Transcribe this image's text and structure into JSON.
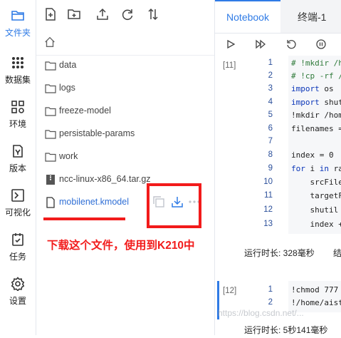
{
  "rail": {
    "items": [
      {
        "label": "文件夹",
        "icon": "folder-icon",
        "active": true
      },
      {
        "label": "数据集",
        "icon": "dataset-icon"
      },
      {
        "label": "环境",
        "icon": "environment-icon"
      },
      {
        "label": "版本",
        "icon": "version-icon"
      },
      {
        "label": "可视化",
        "icon": "visualization-icon"
      },
      {
        "label": "任务",
        "icon": "task-icon"
      },
      {
        "label": "设置",
        "icon": "settings-icon"
      }
    ]
  },
  "file_toolbar": {
    "icons": [
      "new-file-icon",
      "new-folder-icon",
      "upload-icon",
      "refresh-icon",
      "sort-icon"
    ]
  },
  "breadcrumb": {
    "icon": "home-icon"
  },
  "files": [
    {
      "name": "data",
      "type": "folder"
    },
    {
      "name": "logs",
      "type": "folder"
    },
    {
      "name": "freeze-model",
      "type": "folder"
    },
    {
      "name": "persistable-params",
      "type": "folder"
    },
    {
      "name": "work",
      "type": "folder"
    },
    {
      "name": "ncc-linux-x86_64.tar.gz",
      "type": "archive"
    },
    {
      "name": "mobilenet.kmodel",
      "type": "file",
      "selected": true
    }
  ],
  "annotation": {
    "text": "下载这个文件，使用到K210中",
    "color": "#f21b1b"
  },
  "tabs": [
    {
      "label": "Notebook",
      "active": true
    },
    {
      "label": "终端-1",
      "active": false
    }
  ],
  "nb_toolbar": {
    "icons": [
      "run-icon",
      "run-all-icon",
      "restart-icon",
      "stop-icon"
    ]
  },
  "cells": [
    {
      "exec_count": "[11]",
      "lines": [
        {
          "n": "1",
          "text": "# !mkdir /h"
        },
        {
          "n": "2",
          "text": "# !cp -rf /"
        },
        {
          "n": "3",
          "text": "import os"
        },
        {
          "n": "4",
          "text": "import shut"
        },
        {
          "n": "5",
          "text": "!mkdir /hom"
        },
        {
          "n": "6",
          "text": "filenames ="
        },
        {
          "n": "7",
          "text": ""
        },
        {
          "n": "8",
          "text": "index = 0"
        },
        {
          "n": "9",
          "text": "for i in ra"
        },
        {
          "n": "10",
          "text": "    srcFile"
        },
        {
          "n": "11",
          "text": "    targetF"
        },
        {
          "n": "12",
          "text": "    shutil"
        },
        {
          "n": "13",
          "text": "    index +"
        }
      ],
      "status": {
        "runtime": "运行时长: 328毫秒",
        "extra": "结"
      }
    },
    {
      "exec_count": "[12]",
      "lines": [
        {
          "n": "1",
          "text": "!chmod 777"
        },
        {
          "n": "2",
          "text": "!/home/aist"
        }
      ],
      "status": {
        "runtime": "运行时长: 5秒141毫秒"
      }
    }
  ],
  "watermark": "https://blog.csdn.net/...",
  "colors": {
    "accent": "#2f7be6",
    "annotation": "#f21b1b",
    "line_number": "#2b4f9a"
  }
}
